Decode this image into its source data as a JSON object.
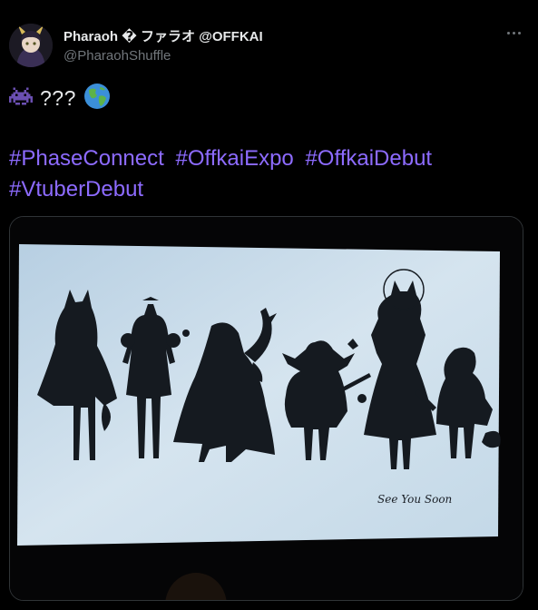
{
  "author": {
    "name": "Pharaoh � ファラオ @OFFKAI",
    "handle": "@PharaohShuffle"
  },
  "tweet": {
    "emoji_alien": "👾",
    "text_questions": "???",
    "emoji_globe": "🌎",
    "hashtags": [
      "#PhaseConnect",
      "#OffkaiExpo",
      "#OffkaiDebut",
      "#VtuberDebut"
    ]
  },
  "media": {
    "caption": "See You Soon",
    "alt": "Projected silhouette lineup of seven characters"
  },
  "colors": {
    "background": "#000000",
    "hashtag": "#8d6bff",
    "muted": "#71767b",
    "screen": "#c9dbe9"
  }
}
